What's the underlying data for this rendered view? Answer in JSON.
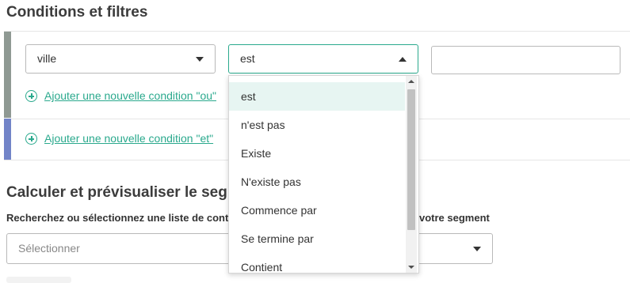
{
  "conditions": {
    "title": "Conditions et filtres",
    "field_select": {
      "value": "ville"
    },
    "operator_select": {
      "value": "est"
    },
    "value_input": {
      "value": ""
    },
    "add_or_link": "Ajouter une nouvelle condition \"ou\"",
    "add_and_link": "Ajouter une nouvelle condition \"et\"",
    "colors": {
      "accent": "#2aa98d",
      "or_bar": "#8f9993",
      "and_bar": "#7284c8"
    }
  },
  "preview": {
    "title_visible": "Calculer et prévisualiser le segm",
    "search_label_left": "Recherchez ou sélectionnez une liste de cont",
    "search_label_right": "votre segment",
    "list_select_placeholder": "Sélectionner"
  },
  "operator_dropdown": {
    "options": [
      "est",
      "n'est pas",
      "Existe",
      "N'existe pas",
      "Commence par",
      "Se termine par",
      "Contient"
    ],
    "selected": "est"
  }
}
